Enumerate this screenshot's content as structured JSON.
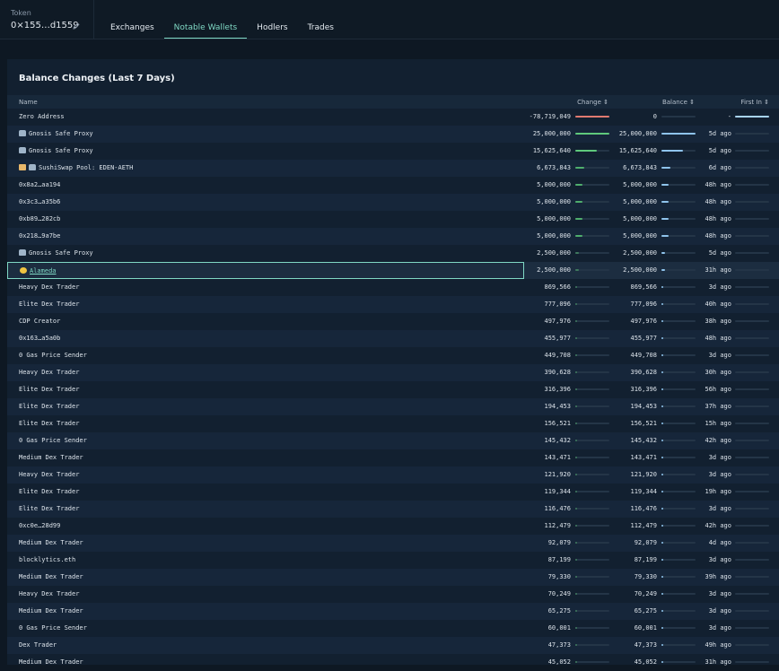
{
  "header": {
    "token_label": "Token",
    "token_address": "0×155…d1559"
  },
  "tabs": [
    {
      "label": "Exchanges",
      "active": false
    },
    {
      "label": "Notable Wallets",
      "active": true
    },
    {
      "label": "Hodlers",
      "active": false
    },
    {
      "label": "Trades",
      "active": false
    }
  ],
  "panel": {
    "title": "Balance Changes (Last 7 Days)",
    "columns": {
      "name": "Name",
      "change": "Change",
      "balance": "Balance",
      "first_in": "First In"
    }
  },
  "colors": {
    "accent": "#7fd8c4",
    "negative": "#e07a70",
    "positive": "#5fc97c",
    "balance_bar": "#8fc4ec"
  },
  "rows": [
    {
      "name": "Zero Address",
      "icon": "",
      "change": "-78,719,049",
      "change_frac": 1.0,
      "negative": true,
      "balance": "0",
      "balance_frac": 0,
      "first_in": "-",
      "first_frac": 1.0
    },
    {
      "name": "Gnosis Safe Proxy",
      "icon": "safe-icon",
      "change": "25,000,000",
      "change_frac": 1.0,
      "balance": "25,000,000",
      "balance_frac": 1.0,
      "first_in": "5d ago",
      "first_frac": 0
    },
    {
      "name": "Gnosis Safe Proxy",
      "icon": "safe-icon",
      "change": "15,625,640",
      "change_frac": 0.63,
      "balance": "15,625,640",
      "balance_frac": 0.63,
      "first_in": "5d ago",
      "first_frac": 0
    },
    {
      "name": "SushiSwap Pool: EDEN-AETH",
      "icon": "pool-icon",
      "change": "6,673,843",
      "change_frac": 0.27,
      "balance": "6,673,843",
      "balance_frac": 0.27,
      "first_in": "6d ago",
      "first_frac": 0
    },
    {
      "name": "0x8a2…aa194",
      "icon": "",
      "change": "5,000,000",
      "change_frac": 0.2,
      "balance": "5,000,000",
      "balance_frac": 0.2,
      "first_in": "48h ago",
      "first_frac": 0
    },
    {
      "name": "0x3c3…a35b6",
      "icon": "",
      "change": "5,000,000",
      "change_frac": 0.2,
      "balance": "5,000,000",
      "balance_frac": 0.2,
      "first_in": "48h ago",
      "first_frac": 0
    },
    {
      "name": "0xb89…282cb",
      "icon": "",
      "change": "5,000,000",
      "change_frac": 0.2,
      "balance": "5,000,000",
      "balance_frac": 0.2,
      "first_in": "48h ago",
      "first_frac": 0
    },
    {
      "name": "0x218…9a7be",
      "icon": "",
      "change": "5,000,000",
      "change_frac": 0.2,
      "balance": "5,000,000",
      "balance_frac": 0.2,
      "first_in": "48h ago",
      "first_frac": 0
    },
    {
      "name": "Gnosis Safe Proxy",
      "icon": "safe-icon",
      "change": "2,500,000",
      "change_frac": 0.1,
      "balance": "2,500,000",
      "balance_frac": 0.1,
      "first_in": "5d ago",
      "first_frac": 0
    },
    {
      "name": "Alameda",
      "icon": "emoji-icon",
      "link": true,
      "highlight": true,
      "change": "2,500,000",
      "change_frac": 0.1,
      "balance": "2,500,000",
      "balance_frac": 0.1,
      "first_in": "31h ago",
      "first_frac": 0
    },
    {
      "name": "Heavy Dex Trader",
      "icon": "",
      "change": "869,566",
      "change_frac": 0.035,
      "balance": "869,566",
      "balance_frac": 0.035,
      "first_in": "3d ago",
      "first_frac": 0
    },
    {
      "name": "Elite Dex Trader",
      "icon": "",
      "change": "777,096",
      "change_frac": 0.031,
      "balance": "777,096",
      "balance_frac": 0.031,
      "first_in": "40h ago",
      "first_frac": 0
    },
    {
      "name": "CDP Creator",
      "icon": "",
      "change": "497,976",
      "change_frac": 0.02,
      "balance": "497,976",
      "balance_frac": 0.02,
      "first_in": "38h ago",
      "first_frac": 0
    },
    {
      "name": "0x163…a5a0b",
      "icon": "",
      "change": "455,977",
      "change_frac": 0.018,
      "balance": "455,977",
      "balance_frac": 0.018,
      "first_in": "48h ago",
      "first_frac": 0
    },
    {
      "name": "0 Gas Price Sender",
      "icon": "",
      "change": "449,708",
      "change_frac": 0.018,
      "balance": "449,708",
      "balance_frac": 0.018,
      "first_in": "3d ago",
      "first_frac": 0
    },
    {
      "name": "Heavy Dex Trader",
      "icon": "",
      "change": "390,628",
      "change_frac": 0.016,
      "balance": "390,628",
      "balance_frac": 0.016,
      "first_in": "30h ago",
      "first_frac": 0
    },
    {
      "name": "Elite Dex Trader",
      "icon": "",
      "change": "316,396",
      "change_frac": 0.013,
      "balance": "316,396",
      "balance_frac": 0.013,
      "first_in": "56h ago",
      "first_frac": 0
    },
    {
      "name": "Elite Dex Trader",
      "icon": "",
      "change": "194,453",
      "change_frac": 0.008,
      "balance": "194,453",
      "balance_frac": 0.008,
      "first_in": "37h ago",
      "first_frac": 0
    },
    {
      "name": "Elite Dex Trader",
      "icon": "",
      "change": "156,521",
      "change_frac": 0.006,
      "balance": "156,521",
      "balance_frac": 0.006,
      "first_in": "15h ago",
      "first_frac": 0
    },
    {
      "name": "0 Gas Price Sender",
      "icon": "",
      "change": "145,432",
      "change_frac": 0.006,
      "balance": "145,432",
      "balance_frac": 0.006,
      "first_in": "42h ago",
      "first_frac": 0
    },
    {
      "name": "Medium Dex Trader",
      "icon": "",
      "change": "143,471",
      "change_frac": 0.006,
      "balance": "143,471",
      "balance_frac": 0.006,
      "first_in": "3d ago",
      "first_frac": 0
    },
    {
      "name": "Heavy Dex Trader",
      "icon": "",
      "change": "121,920",
      "change_frac": 0.005,
      "balance": "121,920",
      "balance_frac": 0.005,
      "first_in": "3d ago",
      "first_frac": 0
    },
    {
      "name": "Elite Dex Trader",
      "icon": "",
      "change": "119,344",
      "change_frac": 0.005,
      "balance": "119,344",
      "balance_frac": 0.005,
      "first_in": "19h ago",
      "first_frac": 0
    },
    {
      "name": "Elite Dex Trader",
      "icon": "",
      "change": "116,476",
      "change_frac": 0.005,
      "balance": "116,476",
      "balance_frac": 0.005,
      "first_in": "3d ago",
      "first_frac": 0
    },
    {
      "name": "0xc0e…28d99",
      "icon": "",
      "change": "112,479",
      "change_frac": 0.004,
      "balance": "112,479",
      "balance_frac": 0.004,
      "first_in": "42h ago",
      "first_frac": 0
    },
    {
      "name": "Medium Dex Trader",
      "icon": "",
      "change": "92,079",
      "change_frac": 0.004,
      "balance": "92,079",
      "balance_frac": 0.004,
      "first_in": "4d ago",
      "first_frac": 0
    },
    {
      "name": "blocklytics.eth",
      "icon": "",
      "change": "87,199",
      "change_frac": 0.003,
      "balance": "87,199",
      "balance_frac": 0.003,
      "first_in": "3d ago",
      "first_frac": 0
    },
    {
      "name": "Medium Dex Trader",
      "icon": "",
      "change": "79,330",
      "change_frac": 0.003,
      "balance": "79,330",
      "balance_frac": 0.003,
      "first_in": "39h ago",
      "first_frac": 0
    },
    {
      "name": "Heavy Dex Trader",
      "icon": "",
      "change": "70,249",
      "change_frac": 0.003,
      "balance": "70,249",
      "balance_frac": 0.003,
      "first_in": "3d ago",
      "first_frac": 0
    },
    {
      "name": "Medium Dex Trader",
      "icon": "",
      "change": "65,275",
      "change_frac": 0.003,
      "balance": "65,275",
      "balance_frac": 0.003,
      "first_in": "3d ago",
      "first_frac": 0
    },
    {
      "name": "0 Gas Price Sender",
      "icon": "",
      "change": "60,001",
      "change_frac": 0.002,
      "balance": "60,001",
      "balance_frac": 0.002,
      "first_in": "3d ago",
      "first_frac": 0
    },
    {
      "name": "Dex Trader",
      "icon": "",
      "change": "47,373",
      "change_frac": 0.002,
      "balance": "47,373",
      "balance_frac": 0.002,
      "first_in": "49h ago",
      "first_frac": 0
    },
    {
      "name": "Medium Dex Trader",
      "icon": "",
      "change": "45,052",
      "change_frac": 0.002,
      "balance": "45,052",
      "balance_frac": 0.002,
      "first_in": "31h ago",
      "first_frac": 0
    }
  ]
}
